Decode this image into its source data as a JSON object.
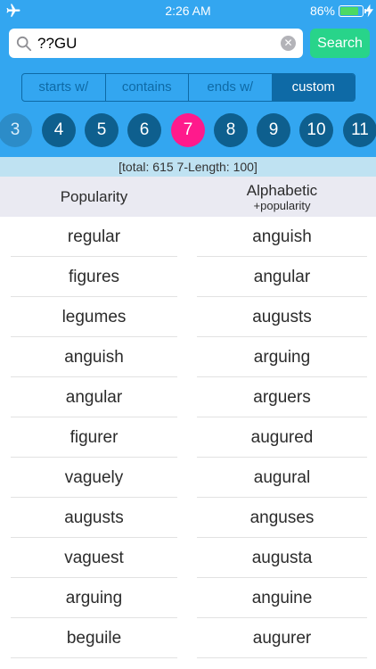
{
  "status_bar": {
    "time": "2:26 AM",
    "battery_percent": "86%",
    "battery_level": 0.86,
    "icons": [
      "airplane-icon",
      "battery-icon",
      "charging-bolt-icon"
    ]
  },
  "search": {
    "value": "??GU",
    "button_label": "Search"
  },
  "segments": {
    "items": [
      "starts w/",
      "contains",
      "ends w/",
      "custom"
    ],
    "selected": "custom"
  },
  "lengths": {
    "items": [
      "3",
      "4",
      "5",
      "6",
      "7",
      "8",
      "9",
      "10",
      "11"
    ],
    "selected": "7"
  },
  "summary": "[total: 615     7-Length: 100]",
  "columns": {
    "left_header": "Popularity",
    "right_header": "Alphabetic",
    "right_subheader": "+popularity"
  },
  "popularity_list": [
    "regular",
    "figures",
    "legumes",
    "anguish",
    "angular",
    "figurer",
    "vaguely",
    "augusts",
    "vaguest",
    "arguing",
    "beguile"
  ],
  "alphabetic_list": [
    "anguish",
    "angular",
    "augusts",
    "arguing",
    "arguers",
    "augured",
    "augural",
    "anguses",
    "augusta",
    "anguine",
    "augurer"
  ],
  "colors": {
    "header_bg": "#33a6f0",
    "search_button": "#28d48a",
    "segment": "#0e6aa6",
    "length_circle": "#0e5f8e",
    "length_selected": "#ff1a8c",
    "summary_bg": "#bfe2f2"
  }
}
